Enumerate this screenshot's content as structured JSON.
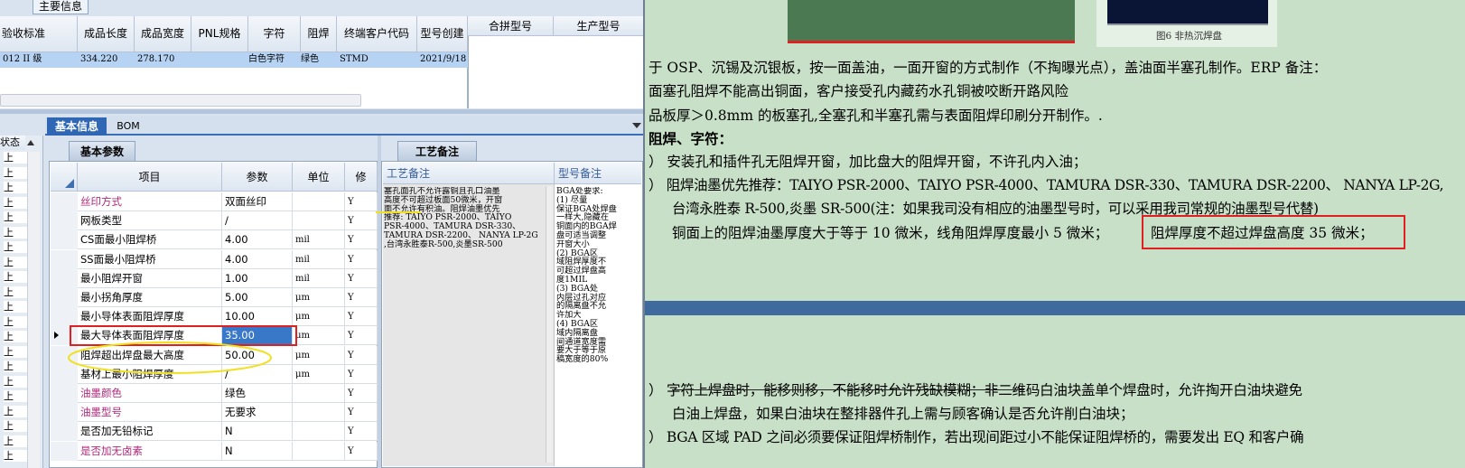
{
  "top_tab": "主要信息",
  "main_grid": {
    "headers": [
      "验收标准",
      "成品长度",
      "成品宽度",
      "PNL规格",
      "字符",
      "阻焊",
      "终端客户代码",
      "型号创建时"
    ],
    "row": [
      "012 II 级",
      "334.220",
      "278.170",
      "",
      "白色字符",
      "绿色",
      "STMD",
      "2021/9/18"
    ]
  },
  "side_grid": {
    "headers": [
      "合拼型号",
      "生产型号"
    ]
  },
  "tabs": {
    "basic": "基本信息",
    "bom": "BOM"
  },
  "subtab": "基本参数",
  "left_header": "状态",
  "left_rows": [
    "上",
    "上",
    "上",
    "上",
    "上",
    "上",
    "上",
    "上",
    "上",
    "上",
    "上",
    "上",
    "上",
    "上",
    "上",
    "上",
    "上",
    "上",
    "上",
    "上",
    "上"
  ],
  "params": {
    "headers": [
      "项目",
      "参数",
      "单位",
      "修"
    ],
    "rows": [
      {
        "item": "丝印方式",
        "value": "双面丝印",
        "unit": "",
        "flag": "Y",
        "pink": true
      },
      {
        "item": "网板类型",
        "value": "/",
        "unit": "",
        "flag": "Y",
        "pink": false
      },
      {
        "item": "CS面最小阻焊桥",
        "value": "4.00",
        "unit": "mil",
        "flag": "Y",
        "pink": false
      },
      {
        "item": "SS面最小阻焊桥",
        "value": "4.00",
        "unit": "mil",
        "flag": "Y",
        "pink": false
      },
      {
        "item": "最小阻焊开窗",
        "value": "1.00",
        "unit": "mil",
        "flag": "Y",
        "pink": false
      },
      {
        "item": "最小拐角厚度",
        "value": "5.00",
        "unit": "μm",
        "flag": "Y",
        "pink": false
      },
      {
        "item": "最小导体表面阻焊厚度",
        "value": "10.00",
        "unit": "μm",
        "flag": "Y",
        "pink": false
      },
      {
        "item": "最大导体表面阻焊厚度",
        "value": "35.00",
        "unit": "μm",
        "flag": "Y",
        "pink": false
      },
      {
        "item": "阻焊超出焊盘最大高度",
        "value": "50.00",
        "unit": "μm",
        "flag": "Y",
        "pink": false
      },
      {
        "item": "基材上最小阻焊厚度",
        "value": "/",
        "unit": "μm",
        "flag": "Y",
        "pink": false
      },
      {
        "item": "油墨颜色",
        "value": "绿色",
        "unit": "",
        "flag": "Y",
        "pink": true
      },
      {
        "item": "油墨型号",
        "value": "无要求",
        "unit": "",
        "flag": "Y",
        "pink": true
      },
      {
        "item": "是否加无铅标记",
        "value": "N",
        "unit": "",
        "flag": "Y",
        "pink": false
      },
      {
        "item": "是否加无卤素",
        "value": "N",
        "unit": "",
        "flag": "Y",
        "pink": true
      }
    ]
  },
  "process": {
    "tab": "工艺备注",
    "col1": "工艺备注",
    "col2": "型号备注",
    "note1": [
      "塞孔面孔不允许露铜且孔口油墨",
      "高度不可超过板面50微米，开窗",
      "面不允许有积油。阻焊油墨优先",
      "推荐: TAIYO PSR-2000、TAIYO",
      "PSR-4000、TAMURA  DSR-330、",
      "TAMURA DSR-2200、 NANYA LP-2G",
      ",台湾永胜泰R-500,炎墨SR-500"
    ],
    "note2": [
      "BGA处要求:",
      "(1)      尽量",
      "保证BGA处焊盘",
      "一样大,隐藏在",
      "铜面内的BGA焊",
      "盘可适当调整",
      "开窗大小",
      "(2)       BGA区",
      "域阻焊厚度不",
      "可超过焊盘高",
      "度1MIL",
      "(3)       BGA处",
      "内层过孔对应",
      "的隔离盘不允",
      "许加大",
      "(4)       BGA区",
      "域内隔离盘",
      "间通道宽度需",
      "要大于等于原",
      "稿宽度的80%"
    ]
  },
  "document": {
    "fig_caption": "图6 非热沉焊盘",
    "lines": [
      "于 OSP、沉锡及沉银板，按一面盖油，一面开窗的方式制作（不掏曝光点），盖油面半塞孔制作。ERP 备注：",
      "面塞孔阻焊不能高出铜面，客户接受孔内藏药水孔铜被咬断开路风险",
      "品板厚＞0.8mm 的板塞孔,全塞孔和半塞孔需与表面阻焊印刷分开制作。.",
      "阻焊、字符：",
      "）  安装孔和插件孔无阻焊开窗，加比盘大的阻焊开窗，不许孔内入油；",
      "）  阻焊油墨优先推荐：TAIYO PSR-2000、TAIYO PSR-4000、TAMURA   DSR-330、TAMURA DSR-2200、 NANYA LP-2G,",
      "台湾永胜泰 R-500,炎墨 SR-500(注：如果我司没有相应的油墨型号时，可以采用我司常规的油墨型号代替)",
      "铜面上的阻焊油墨厚度大于等于 10 微米，线角阻焊厚度最小 5 微米；",
      "阻焊厚度不超过焊盘高度 35 微米；",
      "）  字符上焊盘时，能移则移，不能移时允许残缺模糊；非二维码白油块盖单个焊盘时，允许掏开白油块避免",
      "白油上焊盘，如果白油块在整排器件孔上需与顾客确认是否允许削白油块；",
      "）  BGA 区域 PAD 之间必须要保证阻焊桥制作，若出现间距过小不能保证阻焊桥的，需要发出 EQ 和客户确"
    ]
  }
}
